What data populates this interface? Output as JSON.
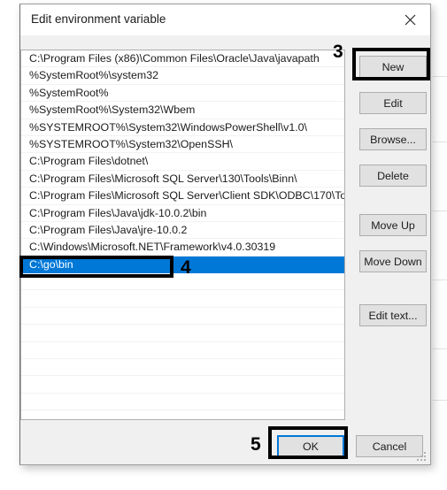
{
  "window": {
    "title": "Edit environment variable",
    "close_icon": "close-icon",
    "close_label": "Close"
  },
  "list": {
    "items": [
      "C:\\Program Files (x86)\\Common Files\\Oracle\\Java\\javapath",
      "%SystemRoot%\\system32",
      "%SystemRoot%",
      "%SystemRoot%\\System32\\Wbem",
      "%SYSTEMROOT%\\System32\\WindowsPowerShell\\v1.0\\",
      "%SYSTEMROOT%\\System32\\OpenSSH\\",
      "C:\\Program Files\\dotnet\\",
      "C:\\Program Files\\Microsoft SQL Server\\130\\Tools\\Binn\\",
      "C:\\Program Files\\Microsoft SQL Server\\Client SDK\\ODBC\\170\\To...",
      "C:\\Program Files\\Java\\jdk-10.0.2\\bin",
      "C:\\Program Files\\Java\\jre-10.0.2",
      "C:\\Windows\\Microsoft.NET\\Framework\\v4.0.30319",
      "C:\\go\\bin"
    ],
    "selected_index": 12,
    "empty_row_count": 8
  },
  "buttons": {
    "new": "New",
    "edit": "Edit",
    "browse": "Browse...",
    "delete": "Delete",
    "move_up": "Move Up",
    "move_down": "Move Down",
    "edit_text": "Edit text...",
    "ok": "OK",
    "cancel": "Cancel"
  },
  "annotations": {
    "step3": "3",
    "step4": "4",
    "step5": "5"
  },
  "colors": {
    "selection_blue": "#0078d7",
    "focus_blue": "#0078d7",
    "annotation_black": "#000000",
    "button_face": "#e1e1e1",
    "dialog_face": "#f0f0f0"
  }
}
